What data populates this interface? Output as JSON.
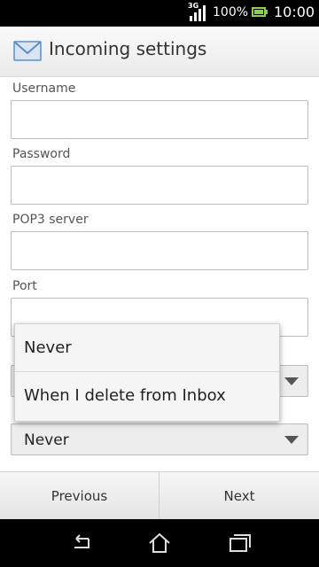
{
  "status_bar": {
    "network": "3G",
    "battery_percent": "100%",
    "time": "10:00",
    "battery_color": "#8bd14a"
  },
  "header": {
    "icon": "mail-icon",
    "title": "Incoming settings"
  },
  "form": {
    "username": {
      "label": "Username",
      "value": ""
    },
    "password": {
      "label": "Password",
      "value": ""
    },
    "pop3_server": {
      "label": "POP3 server",
      "value": ""
    },
    "port": {
      "label": "Port",
      "value": ""
    },
    "security_select": {
      "value": ""
    },
    "delete_select": {
      "value": "Never"
    }
  },
  "popup": {
    "options": [
      "Never",
      "When I delete from Inbox"
    ]
  },
  "buttons": {
    "previous": "Previous",
    "next": "Next"
  },
  "nav": {
    "back": "back-icon",
    "home": "home-icon",
    "recents": "recents-icon"
  }
}
